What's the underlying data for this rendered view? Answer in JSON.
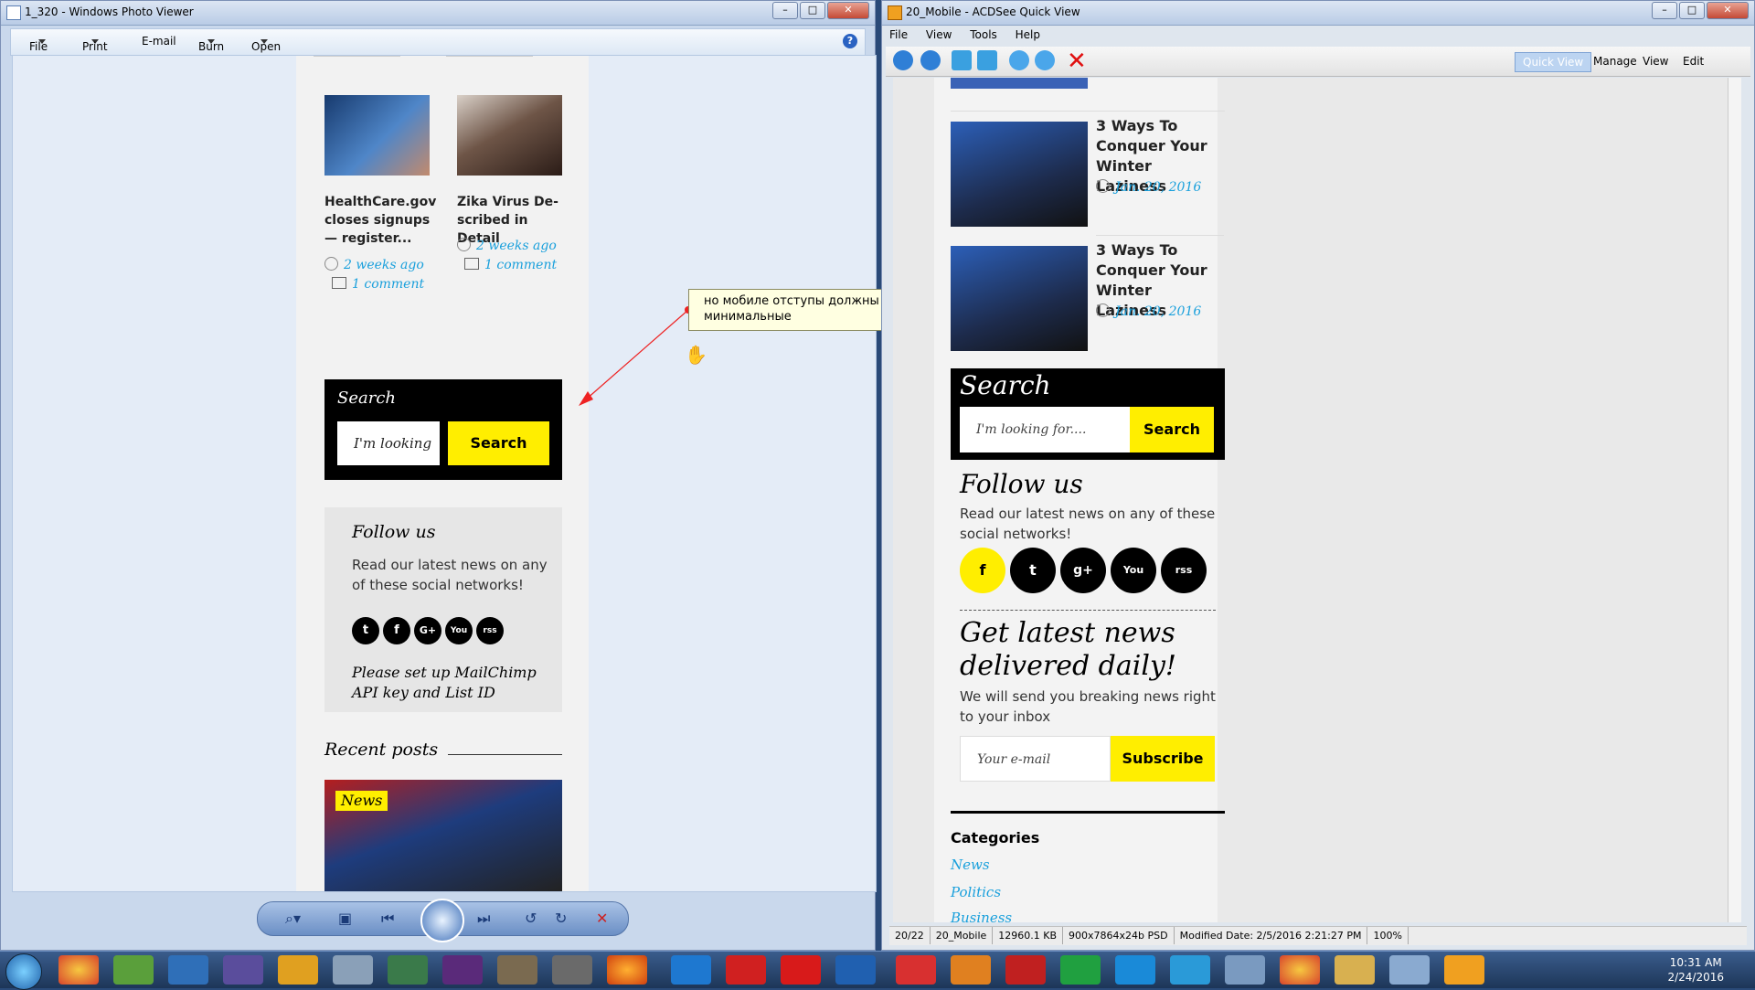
{
  "left_window": {
    "title": "1_320 - Windows Photo Viewer",
    "menu": [
      "File",
      "Print",
      "E-mail",
      "Burn",
      "Open"
    ],
    "help": "?",
    "cards": [
      {
        "title": "HealthCare.gov closes signups — register...",
        "meta_time": "2 weeks ago",
        "meta_comments": "1 comment"
      },
      {
        "title": "Zika Virus De-scribed in Detail",
        "meta_time": "2 weeks ago",
        "meta_comments": "1 comment"
      }
    ],
    "search": {
      "title": "Search",
      "input_value": "I'm looking",
      "button": "Search"
    },
    "follow": {
      "title": "Follow us",
      "text": "Read our latest news on any of these social networks!",
      "icons": [
        "twitter-icon",
        "facebook-icon",
        "google-plus-icon",
        "youtube-icon",
        "rss-icon"
      ],
      "icon_glyphs": [
        "t",
        "f",
        "G+",
        "You",
        "rss"
      ],
      "mailchimp_note": "Please set up MailChimp API key and List ID"
    },
    "recent_posts": {
      "title": "Recent posts",
      "badge": "News"
    }
  },
  "annotation": {
    "text": "но мобиле отступы должны быть минимальные"
  },
  "right_window": {
    "title": "20_Mobile - ACDSee Quick View",
    "menu": [
      "File",
      "View",
      "Tools",
      "Help"
    ],
    "modes": [
      "Quick View",
      "Manage",
      "View",
      "Edit"
    ],
    "articles": [
      {
        "title": "3 Ways To Conquer Your Winter Laziness",
        "date": "Jan. 20, 2016"
      },
      {
        "title": "3 Ways To Conquer Your Winter Laziness",
        "date": "Jan. 20, 2016"
      }
    ],
    "search": {
      "title": "Search",
      "placeholder": "I'm looking for....",
      "button": "Search"
    },
    "follow": {
      "title": "Follow us",
      "text": "Read our latest news on any of these social networks!",
      "icon_glyphs": [
        "f",
        "t",
        "g+",
        "You",
        "rss"
      ]
    },
    "newsletter": {
      "title": "Get latest news delivered daily!",
      "text": "We will send you breaking news right to your inbox",
      "placeholder": "Your e-mail",
      "button": "Subscribe"
    },
    "categories": {
      "title": "Categories",
      "items": [
        "News",
        "Politics",
        "Business"
      ]
    },
    "status": [
      "20/22",
      "20_Mobile",
      "12960.1 KB",
      "900x7864x24b PSD",
      "Modified Date: 2/5/2016 2:21:27 PM",
      "100%"
    ]
  },
  "taskbar": {
    "time": "10:31 AM",
    "date": "2/24/2016"
  },
  "colors": {
    "accent_yellow": "#ffee00",
    "link_blue": "#1aa0dc"
  }
}
